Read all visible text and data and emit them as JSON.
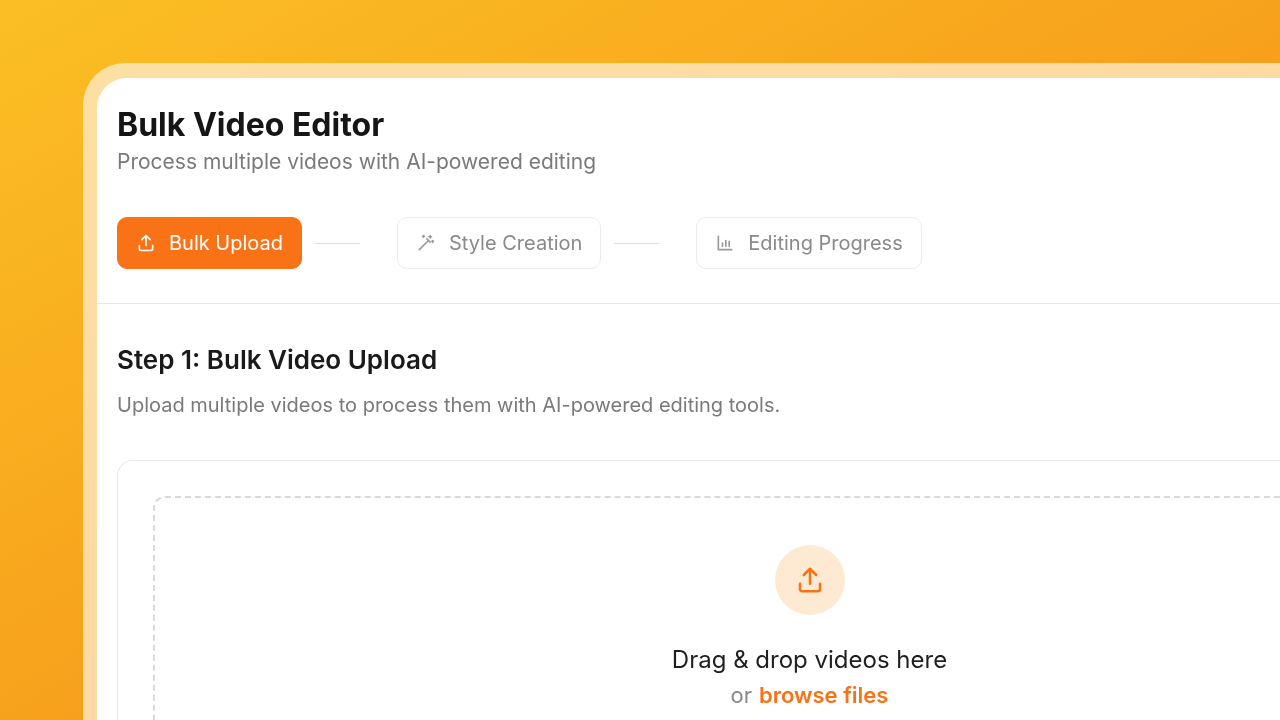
{
  "app": {
    "title": "Bulk Video Editor",
    "subtitle": "Process multiple videos with AI-powered editing"
  },
  "steps": [
    {
      "label": "Bulk Upload",
      "selected": true
    },
    {
      "label": "Style Creation",
      "selected": false
    },
    {
      "label": "Editing Progress",
      "selected": false
    }
  ],
  "section": {
    "heading": "Step 1: Bulk Video Upload",
    "description": "Upload multiple videos to process them with AI-powered editing tools."
  },
  "dropzone": {
    "title": "Drag & drop videos here",
    "prefix": "or",
    "link": "browse files"
  }
}
